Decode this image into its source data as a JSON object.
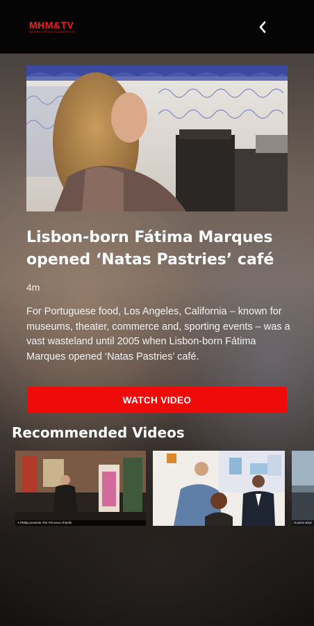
{
  "app": {
    "logo_text": "MHM&TV",
    "logo_subtext": "MODERN HISPANIC MAGAZINE & TV"
  },
  "video": {
    "title": "Lisbon-born Fátima Marques opened ‘Natas Pastries’ café",
    "duration": "4m",
    "description": "For Portuguese food, Los Angeles, California – known for museums, theater, commerce and, sporting events – was a vast wasteland until 2005 when Lisbon-born Fátima Marques opened ‘Natas Pastries’ café.",
    "watch_label": "WATCH VIDEO"
  },
  "recommended": {
    "heading": "Recommended Videos",
    "items": [
      {
        "caption": "A Phillip presents The Princess of Bells"
      },
      {
        "caption": ""
      },
      {
        "caption": "Hudson Blvd"
      }
    ]
  },
  "icons": {
    "back": "chevron-left-icon"
  },
  "colors": {
    "accent": "#f00b0b",
    "logo": "#e8231f",
    "topbar": "#050505"
  }
}
